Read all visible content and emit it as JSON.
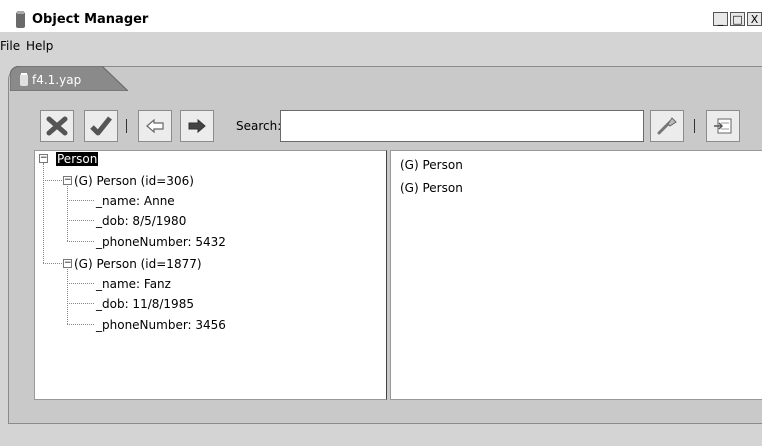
{
  "window": {
    "title": "Object Manager",
    "buttons": [
      "_",
      "□",
      "X"
    ]
  },
  "menu": [
    "File",
    "Help"
  ],
  "tab": {
    "label": "f4.1.yap"
  },
  "toolbar": {
    "search_label": "Search:",
    "search_value": "",
    "icons": [
      "delete-icon",
      "check-icon",
      "back-icon",
      "forward-icon",
      "query-icon",
      "export-icon"
    ]
  },
  "tree": {
    "root": "Person",
    "objects": [
      {
        "label": "(G) Person (id=306)",
        "fields": [
          "_name: Anne",
          "_dob: 8/5/1980",
          "_phoneNumber: 5432"
        ]
      },
      {
        "label": "(G) Person (id=1877)",
        "fields": [
          "_name: Fanz",
          "_dob: 11/8/1985",
          "_phoneNumber: 3456"
        ]
      }
    ]
  },
  "right_list": [
    "(G) Person",
    "(G) Person"
  ]
}
